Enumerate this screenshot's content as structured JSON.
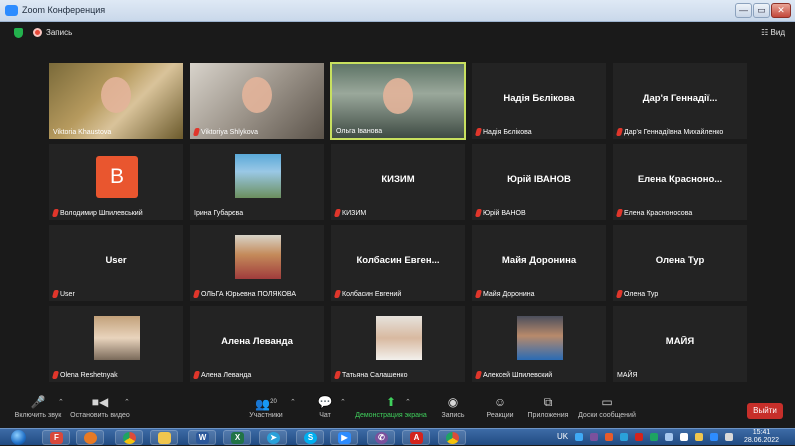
{
  "window": {
    "title": "Zoom Конференция",
    "min": "—",
    "max": "▭",
    "close": "✕"
  },
  "topbar": {
    "record_label": "Запись",
    "view_label": "☷ Вид"
  },
  "participants": [
    {
      "name": "Viktoria Khaustova",
      "muted": false,
      "type": "video"
    },
    {
      "name": "Viktoriya Shlykova",
      "muted": true,
      "type": "video"
    },
    {
      "name": "Ольга Іванова",
      "muted": false,
      "type": "video",
      "active": true
    },
    {
      "name": "Надія Бєлікова",
      "center": "Надія Бєлікова",
      "muted": true,
      "type": "name"
    },
    {
      "name": "Дар'я Геннадіївна Михайленко",
      "center": "Дар'я Геннадії...",
      "muted": true,
      "type": "name"
    },
    {
      "name": "Володимир Шпилевський",
      "muted": true,
      "type": "avatar",
      "avatar_letter": "B"
    },
    {
      "name": "Ірина Губарєва",
      "muted": false,
      "type": "photo"
    },
    {
      "name": "КИЗИМ",
      "center": "КИЗИМ",
      "muted": true,
      "type": "name"
    },
    {
      "name": "Юрій ВАНОВ",
      "center": "Юрій ІВАНОВ",
      "muted": true,
      "type": "name"
    },
    {
      "name": "Елена Красноносова",
      "center": "Елена Красноно...",
      "muted": true,
      "type": "name"
    },
    {
      "name": "User",
      "center": "User",
      "muted": true,
      "type": "name"
    },
    {
      "name": "ОЛЬГА Юрьевна ПОЛЯКОВА",
      "muted": true,
      "type": "photo"
    },
    {
      "name": "Колбасин Евгений",
      "center": "Колбасин Евген...",
      "muted": true,
      "type": "name"
    },
    {
      "name": "Майя Доронина",
      "center": "Майя Доронина",
      "muted": true,
      "type": "name"
    },
    {
      "name": "Олена Тур",
      "center": "Олена Тур",
      "muted": true,
      "type": "name"
    },
    {
      "name": "Olena Reshetnyak",
      "muted": true,
      "type": "photo"
    },
    {
      "name": "Алена Леванда",
      "center": "Алена Леванда",
      "muted": true,
      "type": "name"
    },
    {
      "name": "Татьяна Салашенко",
      "muted": true,
      "type": "photo"
    },
    {
      "name": "Алексей Шпилевский",
      "muted": true,
      "type": "photo"
    },
    {
      "name": "МАЙЯ",
      "center": "МАЙЯ",
      "muted": false,
      "type": "name"
    }
  ],
  "toolbar": {
    "unmute": "Включить звук",
    "stop_video": "Остановить видео",
    "participants": "Участники",
    "participants_count": "20",
    "chat": "Чат",
    "share": "Демонстрация экрана",
    "record": "Запись",
    "reactions": "Реакции",
    "apps": "Приложения",
    "whiteboard": "Доски сообщений",
    "leave": "Выйти"
  },
  "taskbar": {
    "lang": "UK",
    "time": "15:41",
    "date": "28.06.2022"
  }
}
